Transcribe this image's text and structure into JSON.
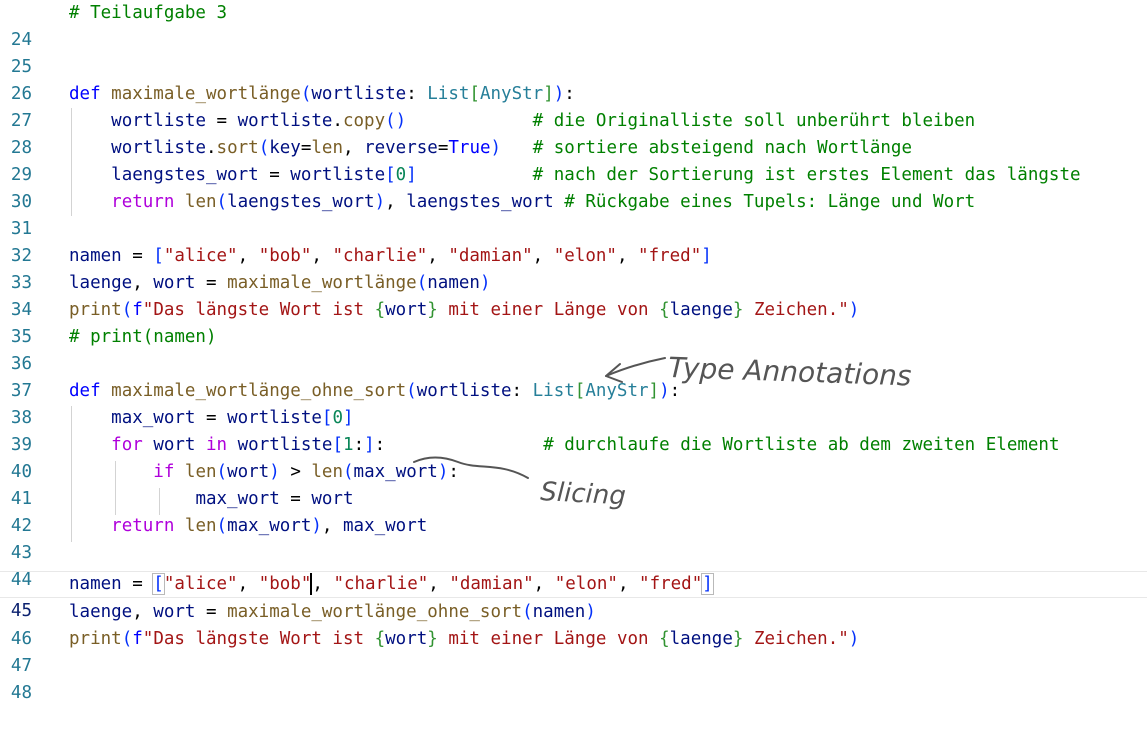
{
  "editor": {
    "line_numbers": [
      "24",
      "25",
      "26",
      "27",
      "28",
      "29",
      "30",
      "31",
      "32",
      "33",
      "34",
      "35",
      "36",
      "37",
      "38",
      "39",
      "40",
      "41",
      "42",
      "43",
      "44",
      "45",
      "46",
      "47",
      "48"
    ],
    "tokens": {
      "t24": "# Teilaufgabe 3",
      "kw_def": "def",
      "kw_return": "return",
      "kw_for": "for",
      "kw_in": "in",
      "kw_if": "if",
      "fn_max": "maximale_wortlänge",
      "fn_max_ohne": "maximale_wortlänge_ohne_sort",
      "fn_copy": "copy",
      "fn_sort": "sort",
      "fn_len": "len",
      "fn_print": "print",
      "var_wortliste": "wortliste",
      "var_key": "key",
      "var_reverse": "reverse",
      "var_laengstes": "laengstes_wort",
      "var_namen": "namen",
      "var_laenge": "laenge",
      "var_wort": "wort",
      "var_max_wort": "max_wort",
      "cls_list": "List",
      "cls_anystr": "AnyStr",
      "bool_true": "True",
      "num_0": "0",
      "num_1": "1",
      "str_alice": "\"alice\"",
      "str_bob": "\"bob\"",
      "str_charlie": "\"charlie\"",
      "str_damian": "\"damian\"",
      "str_elon": "\"elon\"",
      "str_fred": "\"fred\"",
      "fstr_prefix": "f",
      "fstr_start": "\"Das längste Wort ist ",
      "fstr_mid": " mit einer Länge von ",
      "fstr_end": " Zeichen.\"",
      "c28": "# die Originalliste soll unberührt bleiben",
      "c29": "# sortiere absteigend nach Wortlänge",
      "c30": "# nach der Sortierung ist erstes Element das längste",
      "c31": "# Rückgabe eines Tupels: Länge und Wort",
      "c36": "# print(namen)",
      "c40": "# durchlaufe die Wortliste ab dem zweiten Element"
    }
  },
  "annotations": {
    "type_annotations": "Type Annotations",
    "slicing": "Slicing"
  },
  "colors": {
    "keyword": "#0000ff",
    "function": "#795e26",
    "variable": "#001080",
    "class": "#267f99",
    "string": "#a31515",
    "number": "#098658",
    "comment": "#008000",
    "control": "#af00db",
    "line_number": "#237893"
  }
}
